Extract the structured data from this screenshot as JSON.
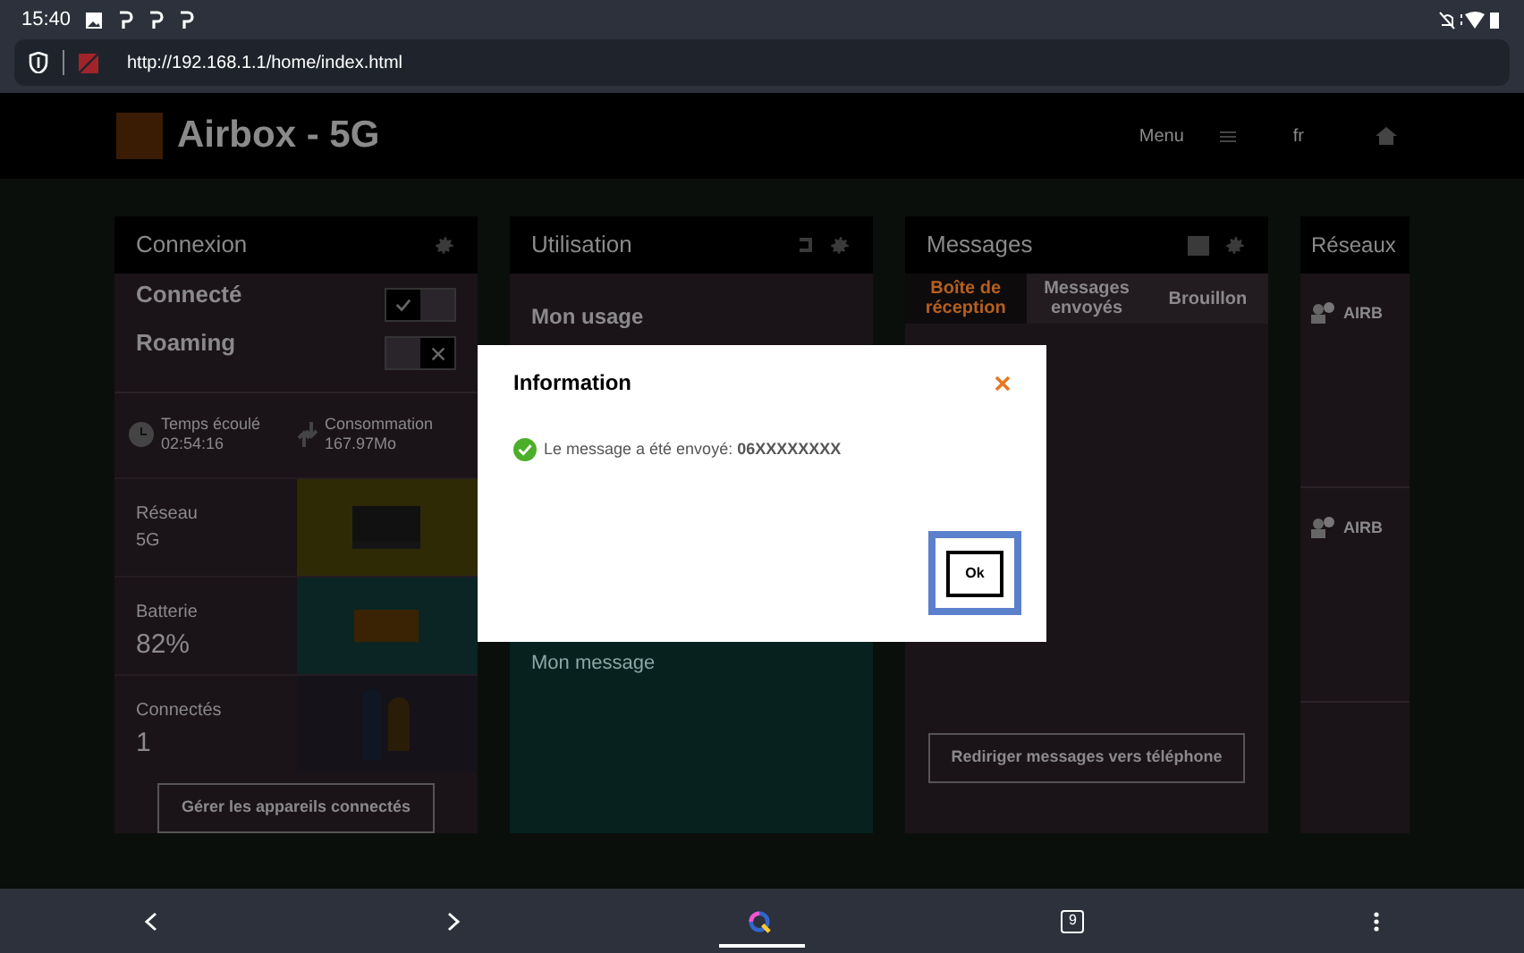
{
  "status_bar": {
    "time": "15:40"
  },
  "browser": {
    "url": "http://192.168.1.1/home/index.html",
    "tab_count": "9"
  },
  "header": {
    "title": "Airbox - 5G",
    "menu": "Menu",
    "language": "fr"
  },
  "connexion": {
    "title": "Connexion",
    "toggles": [
      {
        "label": "Connecté",
        "on": true
      },
      {
        "label": "Roaming",
        "on": false
      }
    ],
    "stats": [
      {
        "label": "Temps écoulé",
        "value": "02:54:16"
      },
      {
        "label": "Consommation",
        "value": "167.97Mo"
      }
    ],
    "tiles": [
      {
        "label": "Réseau",
        "value": "5G",
        "kind": "network"
      },
      {
        "label": "Batterie",
        "value": "82%",
        "kind": "battery"
      },
      {
        "label": "Connectés",
        "value": "1",
        "kind": "devices"
      }
    ],
    "button": "Gérer les appareils connectés"
  },
  "utilisation": {
    "title": "Utilisation",
    "usage_title": "Mon usage",
    "message_title": "Mon message"
  },
  "messages": {
    "title": "Messages",
    "tabs": [
      {
        "label": "Boîte de réception",
        "selected": true
      },
      {
        "label": "Messages envoyés",
        "selected": false
      },
      {
        "label": "Brouillon",
        "selected": false
      }
    ],
    "button": "Rediriger messages vers téléphone"
  },
  "reseaux": {
    "title": "Réseaux",
    "items": [
      "AIRB",
      "AIRB"
    ]
  },
  "dialog": {
    "title": "Information",
    "message": "Le message a été envoyé: **06XXXXXXXX**",
    "button": "Ok"
  }
}
